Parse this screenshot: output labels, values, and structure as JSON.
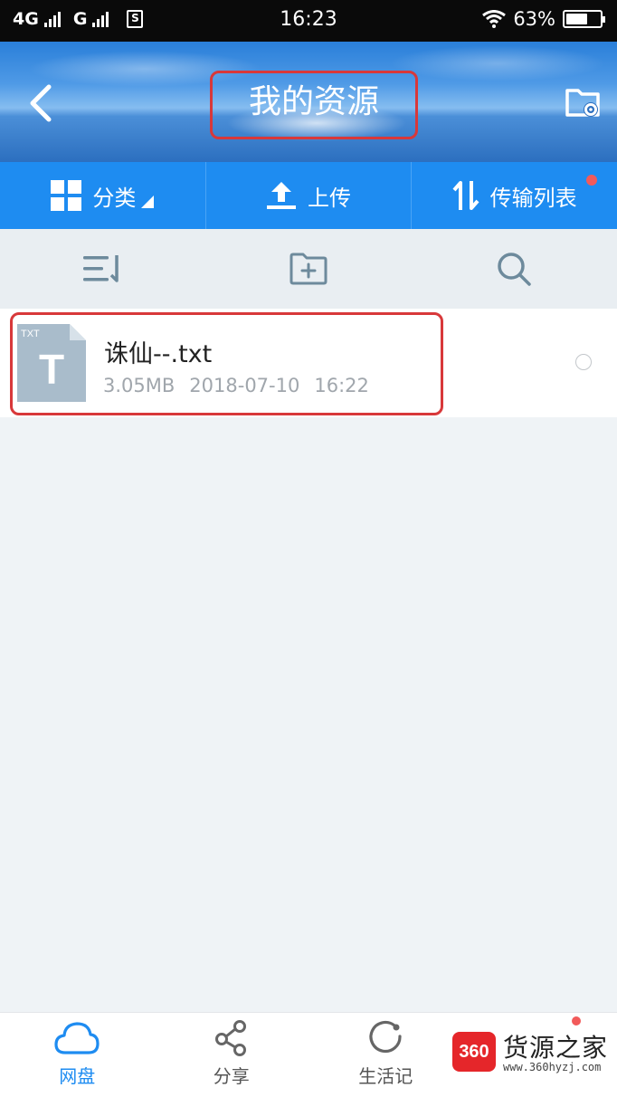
{
  "status_bar": {
    "network_1": "4G",
    "network_2": "G",
    "sim_indicator": "S",
    "time": "16:23",
    "battery": "63%",
    "battery_level": 0.63
  },
  "header": {
    "title": "我的资源",
    "back_icon": "chevron-left-icon",
    "settings_icon": "folder-gear-icon"
  },
  "toolbar": {
    "category_label": "分类",
    "upload_label": "上传",
    "transfer_label": "传输列表"
  },
  "actions": {
    "sort_icon": "sort-list-icon",
    "new_folder_icon": "new-folder-icon",
    "search_icon": "search-icon"
  },
  "files": [
    {
      "name": "诛仙--.txt",
      "size": "3.05MB",
      "date": "2018-07-10",
      "time": "16:22",
      "type_label": "TXT",
      "type_letter": "T"
    }
  ],
  "bottom_nav": {
    "items": [
      {
        "label": "网盘",
        "icon": "cloud-icon",
        "active": true
      },
      {
        "label": "分享",
        "icon": "share-icon",
        "active": false
      },
      {
        "label": "生活记",
        "icon": "refresh-icon",
        "active": false
      }
    ]
  },
  "watermark": {
    "badge": "360",
    "text": "货源之家",
    "url": "www.360hyzj.com"
  },
  "colors": {
    "primary_blue": "#1e8cf1",
    "highlight_red": "#d8383a",
    "notification_red": "#f25a5a",
    "background": "#eff3f6"
  }
}
